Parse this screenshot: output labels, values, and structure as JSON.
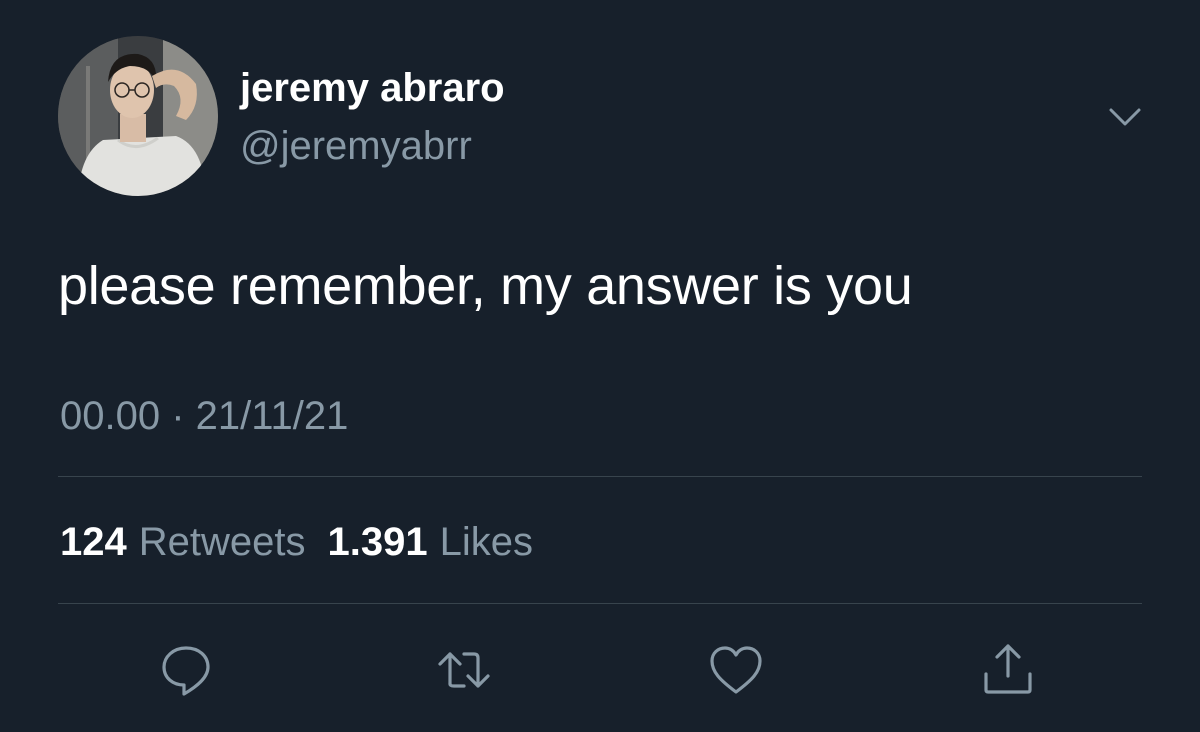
{
  "user": {
    "display_name": "jeremy abraro",
    "handle": "@jeremyabrr"
  },
  "tweet": {
    "text": "please remember, my answer is you",
    "timestamp": "00.00 · 21/11/21"
  },
  "stats": {
    "retweets_count": "124",
    "retweets_label": "Retweets",
    "likes_count": "1.391",
    "likes_label": "Likes"
  },
  "icons": {
    "menu": "chevron-down-icon",
    "reply": "reply-icon",
    "retweet": "retweet-icon",
    "like": "heart-icon",
    "share": "share-icon"
  },
  "colors": {
    "background": "#17202b",
    "primary_text": "#ffffff",
    "secondary_text": "#8899a6",
    "divider": "#38444d"
  }
}
